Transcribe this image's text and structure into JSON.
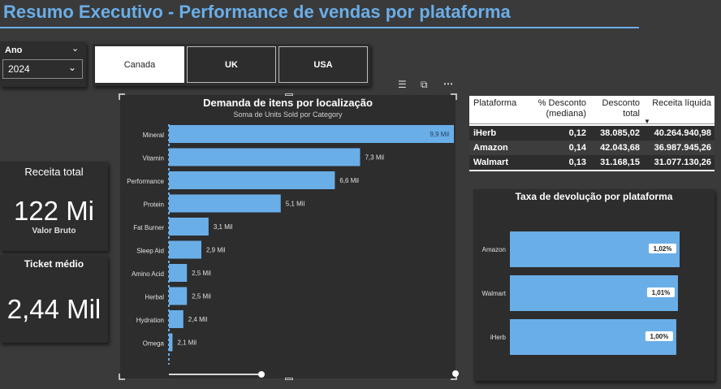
{
  "header": {
    "title": "Resumo Executivo - Performance de vendas por plataforma"
  },
  "year_slicer": {
    "label": "Ano",
    "value": "2024"
  },
  "country_tiles": [
    {
      "label": "Canada",
      "selected": true
    },
    {
      "label": "UK",
      "selected": false
    },
    {
      "label": "USA",
      "selected": false
    }
  ],
  "kpis": {
    "revenue": {
      "title": "Receita total",
      "value": "122 Mi",
      "caption": "Valor Bruto"
    },
    "ticket": {
      "title": "Ticket médio",
      "value": "2,44 Mil"
    }
  },
  "visual_toolbar": {
    "filter_icon": "filter-icon",
    "focus_icon": "focus-mode-icon",
    "more_icon": "more-options-icon"
  },
  "colors": {
    "accent": "#6aaee8",
    "bar": "#6aaee8",
    "background": "#3a3a3a",
    "panel": "#2d2d2d"
  },
  "chart_data": [
    {
      "type": "bar",
      "orientation": "horizontal",
      "title": "Demanda de itens por localização",
      "subtitle": "Soma de Units Sold por Category",
      "categories": [
        "Mineral",
        "Vitamin",
        "Performance",
        "Protein",
        "Fat Burner",
        "Sleep Aid",
        "Amino Acid",
        "Herbal",
        "Hydration",
        "Omega"
      ],
      "values": [
        9.9,
        7.3,
        6.6,
        5.1,
        3.1,
        2.9,
        2.5,
        2.5,
        2.4,
        2.1
      ],
      "data_labels": [
        "9,9 Mil",
        "7,3 Mil",
        "6,6 Mil",
        "5,1 Mil",
        "3,1 Mil",
        "2,9 Mil",
        "2,5 Mil",
        "2,5 Mil",
        "2,4 Mil",
        "2,1 Mil"
      ],
      "xlim": [
        2.0,
        9.9
      ]
    },
    {
      "type": "bar",
      "orientation": "horizontal",
      "title": "Taxa de devolução por plataforma",
      "categories": [
        "Amazon",
        "Walmart",
        "iHerb"
      ],
      "values": [
        1.02,
        1.01,
        1.0
      ],
      "data_labels": [
        "1,02%",
        "1,01%",
        "1,00%"
      ]
    }
  ],
  "platform_table": {
    "columns": [
      "Plataforma",
      "% Desconto (mediana)",
      "Desconto total",
      "Receita líquida"
    ],
    "rows": [
      [
        "iHerb",
        "0,12",
        "38.085,02",
        "40.264.940,98"
      ],
      [
        "Amazon",
        "0,14",
        "42.043,68",
        "36.987.945,26"
      ],
      [
        "Walmart",
        "0,13",
        "31.168,15",
        "31.077.130,26"
      ]
    ]
  }
}
